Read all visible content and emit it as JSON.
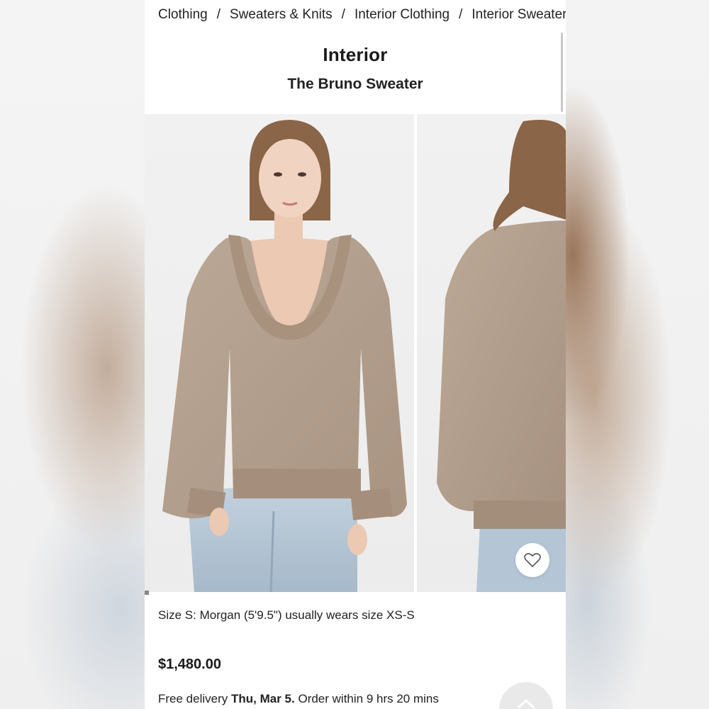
{
  "breadcrumb": {
    "items": [
      "Clothing",
      "Sweaters & Knits",
      "Interior Clothing",
      "Interior Sweaters"
    ],
    "separator": "/"
  },
  "product": {
    "brand": "Interior",
    "name": "The Bruno Sweater",
    "model_info": "Size S: Morgan (5'9.5\") usually wears size XS-S",
    "price": "$1,480.00"
  },
  "delivery": {
    "prefix": "Free delivery",
    "date": "Thu, Mar 5.",
    "suffix": "Order within 9 hrs 20 mins"
  },
  "gallery": {
    "images": [
      {
        "alt": "model-front-view",
        "sweater_color": "#b39f8d"
      },
      {
        "alt": "model-back-view",
        "sweater_color": "#b39f8d"
      }
    ]
  },
  "icons": {
    "favorite": "heart-icon",
    "scroll_top": "chevron-up-icon"
  },
  "colors": {
    "sweater": "#b39f8d",
    "denim": "#b4c6d6",
    "hair": "#8a6548"
  }
}
